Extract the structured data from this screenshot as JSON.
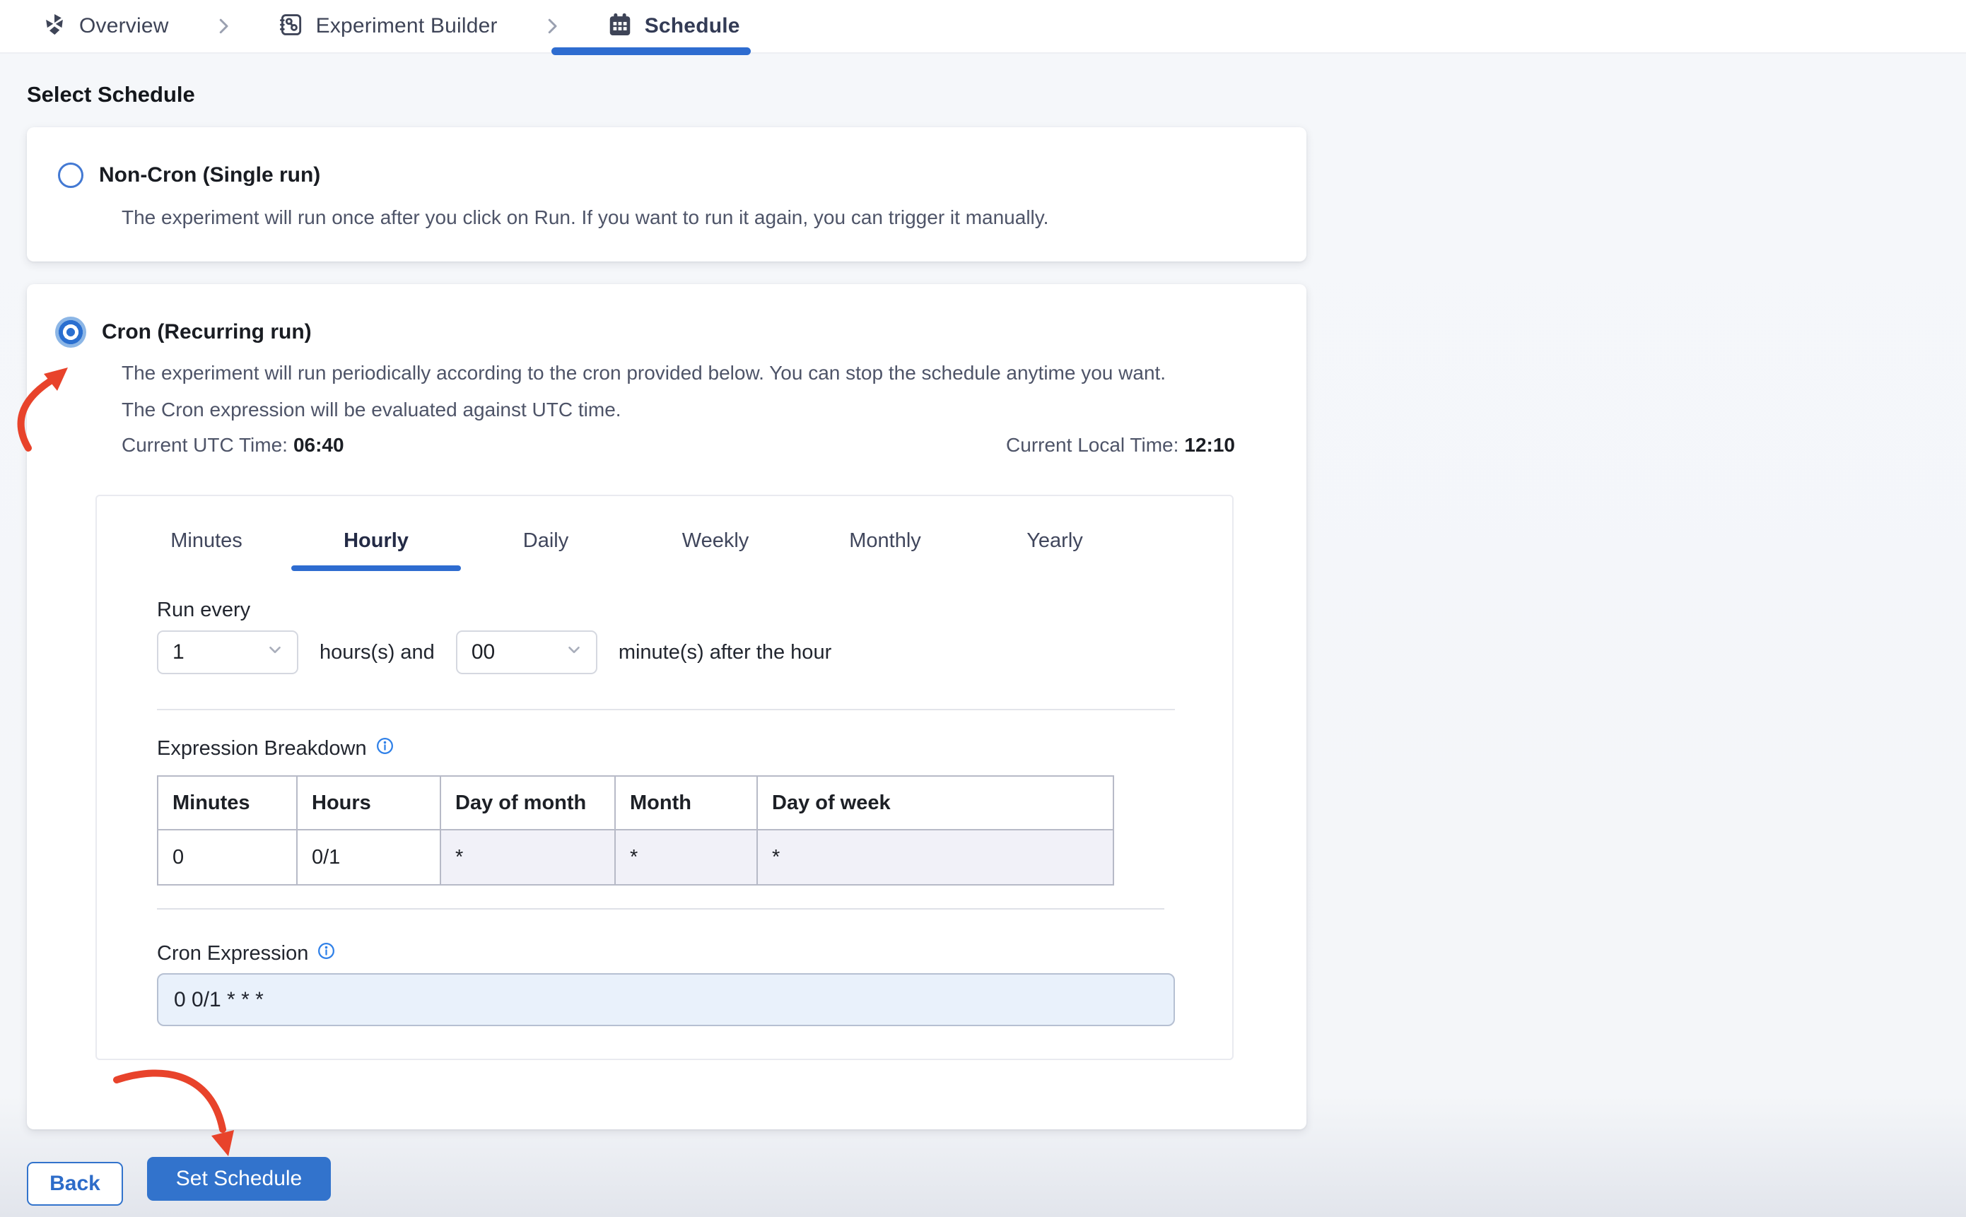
{
  "breadcrumb": {
    "overview_label": "Overview",
    "builder_label": "Experiment Builder",
    "schedule_label": "Schedule"
  },
  "page": {
    "title": "Select Schedule"
  },
  "options": {
    "non_cron": {
      "title": "Non-Cron (Single run)",
      "description": "The experiment will run once after you click on Run. If you want to run it again, you can trigger it manually.",
      "selected": false
    },
    "cron": {
      "title": "Cron (Recurring run)",
      "description_line1": "The experiment will run periodically according to the cron provided below. You can stop the schedule anytime you want.",
      "description_line2": "The Cron expression will be evaluated against UTC time.",
      "utc_label": "Current UTC Time:",
      "utc_value": "06:40",
      "local_label": "Current Local Time:",
      "local_value": "12:10",
      "selected": true
    }
  },
  "builder": {
    "tabs": [
      "Minutes",
      "Hourly",
      "Daily",
      "Weekly",
      "Monthly",
      "Yearly"
    ],
    "active_tab": "Hourly",
    "run_every_label": "Run every",
    "hours_value": "1",
    "hours_suffix": "hours(s) and",
    "minutes_value": "00",
    "minutes_suffix": "minute(s) after the hour",
    "breakdown_label": "Expression Breakdown",
    "table": {
      "headers": [
        "Minutes",
        "Hours",
        "Day of month",
        "Month",
        "Day of week"
      ],
      "values": [
        "0",
        "0/1",
        "*",
        "*",
        "*"
      ]
    },
    "cron_label": "Cron Expression",
    "cron_value": "0 0/1 * * *"
  },
  "footer": {
    "back_label": "Back",
    "set_schedule_label": "Set Schedule"
  },
  "colors": {
    "accent_blue": "#3273cc",
    "tab_underline_blue": "#2e6cd0",
    "radio_halo_blue": "#8cb6e6",
    "info_icon_blue": "#2f80e8",
    "annotation_arrow_red": "#e8432b",
    "highlight_cell_bg": "#f1f1f8",
    "cron_input_bg": "#e9f1fb"
  }
}
